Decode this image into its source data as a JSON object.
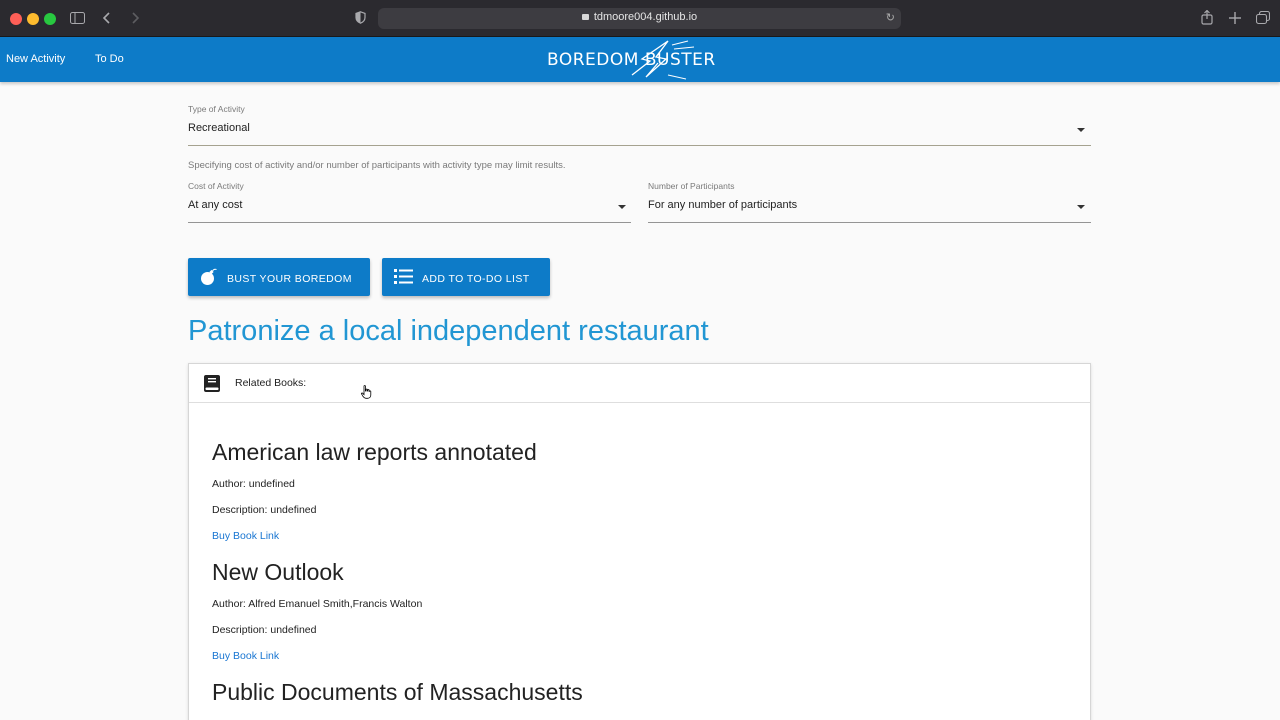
{
  "browser": {
    "url": "tdmoore004.github.io"
  },
  "appbar": {
    "nav": [
      "New Activity",
      "To Do"
    ],
    "logo": "BOREDOM BUSTER",
    "color": "#0d7bc8"
  },
  "form": {
    "type": {
      "label": "Type of Activity",
      "value": "Recreational"
    },
    "hint": "Specifying cost of activity and/or number of participants with activity type may limit results.",
    "cost": {
      "label": "Cost of Activity",
      "value": "At any cost"
    },
    "participants": {
      "label": "Number of Participants",
      "value": "For any number of participants"
    }
  },
  "buttons": {
    "bust": {
      "label": "BUST YOUR BOREDOM",
      "icon": "bomb-icon"
    },
    "add": {
      "label": "ADD TO TO-DO LIST",
      "icon": "list-icon"
    }
  },
  "activity": {
    "title": "Patronize a local independent restaurant",
    "color": "#2196d3"
  },
  "related": {
    "header": "Related Books:",
    "books": [
      {
        "title": "American law reports annotated",
        "author": "Author: undefined",
        "description": "Description: undefined",
        "link": "Buy Book Link"
      },
      {
        "title": "New Outlook",
        "author": "Author: Alfred Emanuel Smith,Francis Walton",
        "description": "Description: undefined",
        "link": "Buy Book Link"
      },
      {
        "title": "Public Documents of Massachusetts"
      }
    ]
  }
}
